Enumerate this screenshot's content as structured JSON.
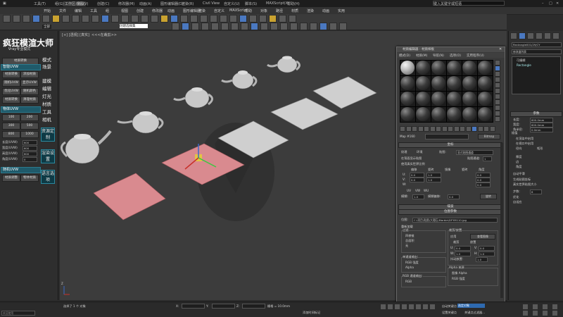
{
  "titlebar": {
    "workspace": "工作区: 默认",
    "search_placeholder": "键入关键字或短语",
    "items": [
      "工具(T)",
      "组(G)",
      "视图(V)",
      "创建(C)",
      "修改器(M)",
      "动画(A)",
      "图形编辑器(D)",
      "渲染(R)",
      "Civil View",
      "自定义(U)",
      "脚本(S)",
      "MAXScript(X)",
      "帮助(H)"
    ]
  },
  "menubar": {
    "items": [
      "开始",
      "文件",
      "编辑",
      "工具",
      "组",
      "视图",
      "创建",
      "修改器",
      "动画",
      "图形编辑器",
      "渲染",
      "自定义",
      "MAXScript",
      "帮助",
      "对象",
      "路径",
      "材质",
      "渲染",
      "动画",
      "实用"
    ]
  },
  "toolbar": {
    "view_select": "全部",
    "frame_label": "视图",
    "create_selection": "创建选择集"
  },
  "viewport": {
    "label_left": "[+] [透视] [真实]",
    "label_mid": "<<<在裁剪>>",
    "axis_label": "Z"
  },
  "left_panel": {
    "brand": "疯狂模渲大师",
    "brand_sub": "Vray专业模式",
    "side_big": [
      "模式",
      "场景",
      "建模",
      "编辑",
      "灯光",
      "材质",
      "工具",
      "相机"
    ],
    "section1_btn": "材质转换",
    "section_heads": [
      "智能UVW",
      "物体UVW",
      "随机UVW"
    ],
    "uvw_buttons": [
      "材质转换",
      "添加材质",
      "随机UVW",
      "显示UVW",
      "优化UVW",
      "随机颜色",
      "材质转换",
      "清理材质"
    ],
    "grid_buttons": [
      "100",
      "200",
      "300",
      "500",
      "800",
      "1000"
    ],
    "fields": [
      {
        "label": "长度(UVW)",
        "value": "600"
      },
      {
        "label": "宽度(UVW)",
        "value": "600"
      },
      {
        "label": "高度(UVW)",
        "value": "600"
      },
      {
        "label": "角度(UVW)",
        "value": "0"
      }
    ],
    "bottom_buttons": [
      "材质调整",
      "物体材质"
    ],
    "cyan_buttons": [
      "资源定制",
      "渲染设置",
      "语言选项"
    ]
  },
  "material_editor": {
    "title": "材质编辑器 - 材质样板",
    "menu": [
      "模式(D)",
      "材质(M)",
      "导航(N)",
      "选项(O)",
      "实用程序(U)"
    ],
    "material_name": "Map #160",
    "material_type": "Bitmap",
    "coord_rollout": "坐标",
    "coord": {
      "texture_label": "纹理",
      "env_label": "环境",
      "mapping_label": "贴图:",
      "mapping_value": "显式贴图通道",
      "show_map_back": "在背面显示贴图",
      "use_real_world": "使用真实世界比例",
      "map_channel_label": "贴图通道:",
      "map_channel_value": "1",
      "headers": [
        "偏移",
        "瓷砖",
        "镜像",
        "瓷砖",
        "角度"
      ],
      "rows": [
        {
          "axis": "U:",
          "offset": "0.0",
          "tiling": "1.0",
          "angle": "0.0"
        },
        {
          "axis": "V:",
          "offset": "0.0",
          "tiling": "1.0",
          "angle": "0.0"
        },
        {
          "axis": "W:",
          "offset": "",
          "tiling": "",
          "angle": "0.0"
        }
      ],
      "uv_options": [
        "UV",
        "VW",
        "WU"
      ],
      "blur_label": "模糊:",
      "blur_value": "1.0",
      "blur_offset_label": "模糊偏移:",
      "blur_offset_value": "0.0",
      "rotate_btn": "旋转"
    },
    "noise_rollout": "噪波",
    "bitmap_rollout": "位图参数",
    "bitmap": {
      "path_label": "位图:",
      "path_value": "C:\\项目\\贴图\\大理石\\Marble\\DFYM110.jpg",
      "reload": "重新加载",
      "filter_label": "过滤",
      "filter_options": [
        "四棱锥",
        "总面积",
        "无"
      ],
      "crop_label": "裁剪/放置",
      "apply": "应用",
      "view_image": "查看图像",
      "crop": "裁剪",
      "place": "放置",
      "fields": [
        {
          "label": "U:",
          "value": "0.0"
        },
        {
          "label": "V:",
          "value": "0.0"
        },
        {
          "label": "W:",
          "value": "1.0"
        },
        {
          "label": "H:",
          "value": "1.0"
        }
      ],
      "jitter_label": "抖动放置:",
      "jitter_value": "1.0",
      "mono_label": "单通道输出:",
      "mono_options": [
        "RGB 强度",
        "Alpha"
      ],
      "rgb_label": "RGB 通道输出:",
      "rgb_options": [
        "RGB"
      ],
      "alpha_source_label": "Alpha 来源",
      "alpha_options": [
        "图像 Alpha",
        "RGB 强度"
      ]
    }
  },
  "right_panel": {
    "object_name": "Rectangle001/29/CY",
    "modifier_list": "修改器列表",
    "stack": [
      "可编辑",
      "Rectangle"
    ],
    "params_title": "参数",
    "fields": [
      {
        "label": "长度:",
        "value": "600.0mm"
      },
      {
        "label": "宽度:",
        "value": "600.0mm"
      },
      {
        "label": "角半径:",
        "value": "0.0mm"
      }
    ],
    "interp": "插值",
    "render_opts": [
      "在渲染中启用",
      "在视口中启用"
    ],
    "radial": "径向",
    "rect": "矩形",
    "sides": [
      "厚度",
      "边",
      "角度"
    ],
    "ik_label": "自动平滑",
    "checks": [
      "生成贴图坐标",
      "真实世界贴图大小"
    ],
    "step_label": "步数:",
    "step_value": "6",
    "optimize": "优化",
    "adaptive": "自适应"
  },
  "statusbar": {
    "prompt_left": "欢迎使用",
    "script_label": "MAXScript 迷你侦听器",
    "status_text": "选择了 1 个 对象",
    "grid_label": "栅格 = 10.0mm",
    "add_time_tag": "添加时间标记",
    "auto_key": "自动关键点",
    "set_key": "设置关键点",
    "selected": "选定对象",
    "key_filters": "关键点过滤器...",
    "x_label": "X:",
    "x_value": "",
    "y_label": "Y:",
    "y_value": "",
    "z_label": "Z:",
    "z_value": ""
  },
  "colors": {
    "accent_cyan": "#1f5a6a",
    "plane_pink": "#d98a8f",
    "marble": "#cfcfcf",
    "viewport_bg": "#3c3c3c"
  }
}
